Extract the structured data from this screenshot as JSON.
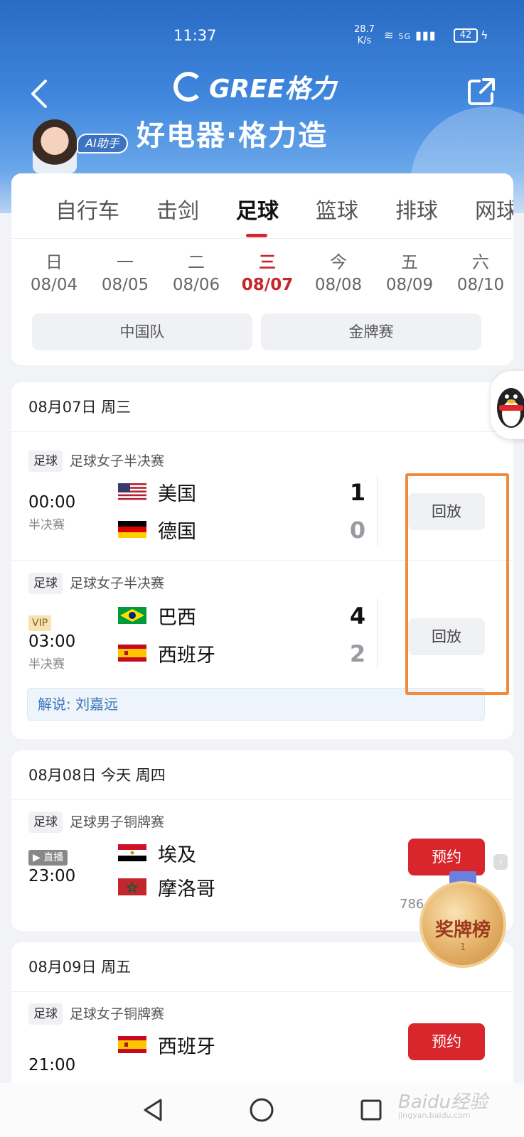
{
  "status_bar": {
    "time": "11:37",
    "speed": "28.7",
    "speed_unit": "K/s",
    "signal": "5G",
    "battery": "42"
  },
  "header": {
    "brand": "GREE格力",
    "slogan": "好电器·格力造",
    "ai_tag": "AI助手"
  },
  "sport_tabs": [
    "自行车",
    "击剑",
    "足球",
    "篮球",
    "排球",
    "网球"
  ],
  "active_sport": "足球",
  "dates": [
    {
      "weekday": "日",
      "date": "08/04"
    },
    {
      "weekday": "一",
      "date": "08/05"
    },
    {
      "weekday": "二",
      "date": "08/06"
    },
    {
      "weekday": "三",
      "date": "08/07"
    },
    {
      "weekday": "今",
      "date": "08/08"
    },
    {
      "weekday": "五",
      "date": "08/09"
    },
    {
      "weekday": "六",
      "date": "08/10"
    }
  ],
  "active_date": "08/07",
  "filters": [
    "中国队",
    "金牌赛"
  ],
  "days": [
    {
      "title": "08月07日 周三",
      "matches": [
        {
          "sport": "足球",
          "event": "足球女子半决赛",
          "time": "00:00",
          "stage": "半决赛",
          "team1": "美国",
          "score1": "1",
          "team2": "德国",
          "score2": "0",
          "action": "回放"
        },
        {
          "sport": "足球",
          "event": "足球女子半决赛",
          "badge": "VIP",
          "time": "03:00",
          "stage": "半决赛",
          "team1": "巴西",
          "score1": "4",
          "team2": "西班牙",
          "score2": "2",
          "action": "回放"
        }
      ],
      "commentary": "解说: 刘嘉远"
    },
    {
      "title": "08月08日 今天 周四",
      "matches": [
        {
          "sport": "足球",
          "event": "足球男子铜牌赛",
          "badge": "▶ 直播",
          "time": "23:00",
          "team1": "埃及",
          "team2": "摩洛哥",
          "action": "预约",
          "views": "786"
        }
      ]
    },
    {
      "title": "08月09日 周五",
      "matches": [
        {
          "sport": "足球",
          "event": "足球女子铜牌赛",
          "time": "21:00",
          "team1": "西班牙",
          "action": "预约"
        }
      ]
    }
  ],
  "medal_widget": {
    "label": "奖牌榜",
    "rank": "1"
  },
  "watermark": {
    "text": "Baidu经验",
    "sub": "jingyan.baidu.com"
  },
  "colors": {
    "accent": "#d9262c",
    "header_blue": "#3f86dd",
    "highlight": "#f08a3c"
  }
}
